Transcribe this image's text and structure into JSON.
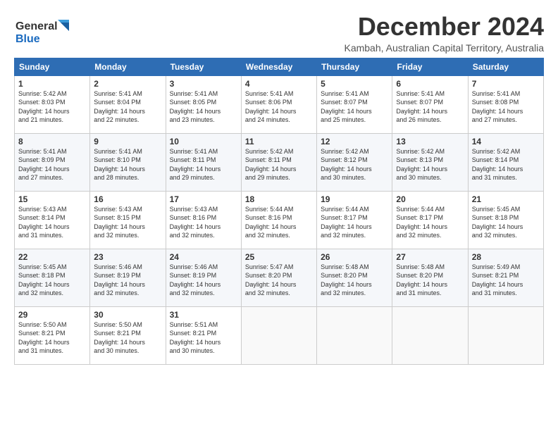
{
  "logo": {
    "line1": "General",
    "line2": "Blue"
  },
  "title": "December 2024",
  "subtitle": "Kambah, Australian Capital Territory, Australia",
  "weekdays": [
    "Sunday",
    "Monday",
    "Tuesday",
    "Wednesday",
    "Thursday",
    "Friday",
    "Saturday"
  ],
  "weeks": [
    [
      {
        "day": "1",
        "info": "Sunrise: 5:42 AM\nSunset: 8:03 PM\nDaylight: 14 hours\nand 21 minutes."
      },
      {
        "day": "2",
        "info": "Sunrise: 5:41 AM\nSunset: 8:04 PM\nDaylight: 14 hours\nand 22 minutes."
      },
      {
        "day": "3",
        "info": "Sunrise: 5:41 AM\nSunset: 8:05 PM\nDaylight: 14 hours\nand 23 minutes."
      },
      {
        "day": "4",
        "info": "Sunrise: 5:41 AM\nSunset: 8:06 PM\nDaylight: 14 hours\nand 24 minutes."
      },
      {
        "day": "5",
        "info": "Sunrise: 5:41 AM\nSunset: 8:07 PM\nDaylight: 14 hours\nand 25 minutes."
      },
      {
        "day": "6",
        "info": "Sunrise: 5:41 AM\nSunset: 8:07 PM\nDaylight: 14 hours\nand 26 minutes."
      },
      {
        "day": "7",
        "info": "Sunrise: 5:41 AM\nSunset: 8:08 PM\nDaylight: 14 hours\nand 27 minutes."
      }
    ],
    [
      {
        "day": "8",
        "info": "Sunrise: 5:41 AM\nSunset: 8:09 PM\nDaylight: 14 hours\nand 27 minutes."
      },
      {
        "day": "9",
        "info": "Sunrise: 5:41 AM\nSunset: 8:10 PM\nDaylight: 14 hours\nand 28 minutes."
      },
      {
        "day": "10",
        "info": "Sunrise: 5:41 AM\nSunset: 8:11 PM\nDaylight: 14 hours\nand 29 minutes."
      },
      {
        "day": "11",
        "info": "Sunrise: 5:42 AM\nSunset: 8:11 PM\nDaylight: 14 hours\nand 29 minutes."
      },
      {
        "day": "12",
        "info": "Sunrise: 5:42 AM\nSunset: 8:12 PM\nDaylight: 14 hours\nand 30 minutes."
      },
      {
        "day": "13",
        "info": "Sunrise: 5:42 AM\nSunset: 8:13 PM\nDaylight: 14 hours\nand 30 minutes."
      },
      {
        "day": "14",
        "info": "Sunrise: 5:42 AM\nSunset: 8:14 PM\nDaylight: 14 hours\nand 31 minutes."
      }
    ],
    [
      {
        "day": "15",
        "info": "Sunrise: 5:43 AM\nSunset: 8:14 PM\nDaylight: 14 hours\nand 31 minutes."
      },
      {
        "day": "16",
        "info": "Sunrise: 5:43 AM\nSunset: 8:15 PM\nDaylight: 14 hours\nand 32 minutes."
      },
      {
        "day": "17",
        "info": "Sunrise: 5:43 AM\nSunset: 8:16 PM\nDaylight: 14 hours\nand 32 minutes."
      },
      {
        "day": "18",
        "info": "Sunrise: 5:44 AM\nSunset: 8:16 PM\nDaylight: 14 hours\nand 32 minutes."
      },
      {
        "day": "19",
        "info": "Sunrise: 5:44 AM\nSunset: 8:17 PM\nDaylight: 14 hours\nand 32 minutes."
      },
      {
        "day": "20",
        "info": "Sunrise: 5:44 AM\nSunset: 8:17 PM\nDaylight: 14 hours\nand 32 minutes."
      },
      {
        "day": "21",
        "info": "Sunrise: 5:45 AM\nSunset: 8:18 PM\nDaylight: 14 hours\nand 32 minutes."
      }
    ],
    [
      {
        "day": "22",
        "info": "Sunrise: 5:45 AM\nSunset: 8:18 PM\nDaylight: 14 hours\nand 32 minutes."
      },
      {
        "day": "23",
        "info": "Sunrise: 5:46 AM\nSunset: 8:19 PM\nDaylight: 14 hours\nand 32 minutes."
      },
      {
        "day": "24",
        "info": "Sunrise: 5:46 AM\nSunset: 8:19 PM\nDaylight: 14 hours\nand 32 minutes."
      },
      {
        "day": "25",
        "info": "Sunrise: 5:47 AM\nSunset: 8:20 PM\nDaylight: 14 hours\nand 32 minutes."
      },
      {
        "day": "26",
        "info": "Sunrise: 5:48 AM\nSunset: 8:20 PM\nDaylight: 14 hours\nand 32 minutes."
      },
      {
        "day": "27",
        "info": "Sunrise: 5:48 AM\nSunset: 8:20 PM\nDaylight: 14 hours\nand 31 minutes."
      },
      {
        "day": "28",
        "info": "Sunrise: 5:49 AM\nSunset: 8:21 PM\nDaylight: 14 hours\nand 31 minutes."
      }
    ],
    [
      {
        "day": "29",
        "info": "Sunrise: 5:50 AM\nSunset: 8:21 PM\nDaylight: 14 hours\nand 31 minutes."
      },
      {
        "day": "30",
        "info": "Sunrise: 5:50 AM\nSunset: 8:21 PM\nDaylight: 14 hours\nand 30 minutes."
      },
      {
        "day": "31",
        "info": "Sunrise: 5:51 AM\nSunset: 8:21 PM\nDaylight: 14 hours\nand 30 minutes."
      },
      {
        "day": "",
        "info": ""
      },
      {
        "day": "",
        "info": ""
      },
      {
        "day": "",
        "info": ""
      },
      {
        "day": "",
        "info": ""
      }
    ]
  ]
}
